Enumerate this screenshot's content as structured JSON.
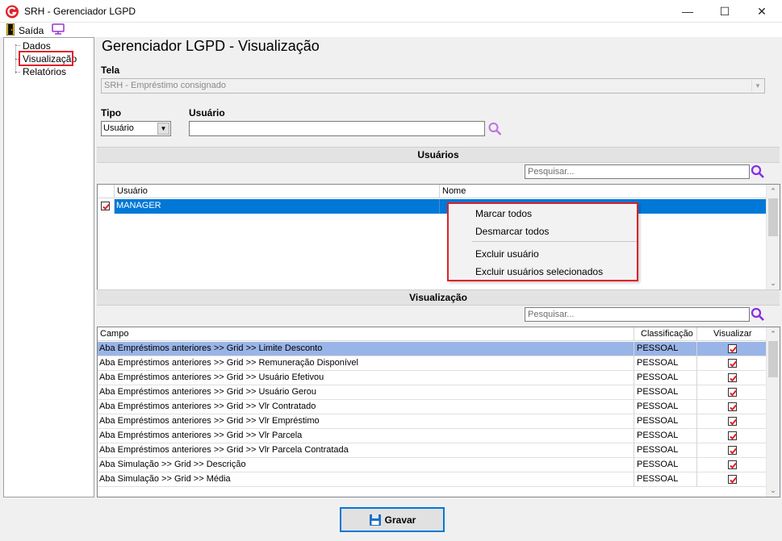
{
  "window": {
    "title": "SRH - Gerenciador LGPD",
    "minimize_glyph": "—",
    "maximize_glyph": "☐",
    "close_glyph": "✕"
  },
  "menu": {
    "exit_label": "Saída"
  },
  "tree": {
    "items": [
      {
        "label": "Dados"
      },
      {
        "label": "Visualização",
        "selected": true
      },
      {
        "label": "Relatórios"
      }
    ]
  },
  "page": {
    "title": "Gerenciador LGPD - Visualização",
    "tela_label": "Tela",
    "tela_value": "SRH - Empréstimo consignado",
    "tipo_label": "Tipo",
    "tipo_value": "Usuário",
    "usuario_label": "Usuário",
    "usuario_value": ""
  },
  "users_section": {
    "title": "Usuários",
    "search_placeholder": "Pesquisar...",
    "columns": [
      "Usuário",
      "Nome"
    ],
    "rows": [
      {
        "checked": true,
        "usuario": "MANAGER",
        "nome": ""
      }
    ]
  },
  "context_menu": {
    "items": [
      "Marcar todos",
      "Desmarcar todos",
      "Excluir usuário",
      "Excluir usuários selecionados"
    ]
  },
  "view_section": {
    "title": "Visualização",
    "search_placeholder": "Pesquisar...",
    "columns": [
      "Campo",
      "Classificação",
      "Visualizar"
    ],
    "rows": [
      {
        "campo": "Aba Empréstimos anteriores >> Grid >> Limite Desconto",
        "classificacao": "PESSOAL",
        "visualizar": true
      },
      {
        "campo": "Aba Empréstimos anteriores >> Grid >> Remuneração Disponível",
        "classificacao": "PESSOAL",
        "visualizar": true
      },
      {
        "campo": "Aba Empréstimos anteriores >> Grid >> Usuário Efetivou",
        "classificacao": "PESSOAL",
        "visualizar": true
      },
      {
        "campo": "Aba Empréstimos anteriores >> Grid >> Usuário Gerou",
        "classificacao": "PESSOAL",
        "visualizar": true
      },
      {
        "campo": "Aba Empréstimos anteriores >> Grid >> Vlr Contratado",
        "classificacao": "PESSOAL",
        "visualizar": true
      },
      {
        "campo": "Aba Empréstimos anteriores >> Grid >> Vlr Empréstimo",
        "classificacao": "PESSOAL",
        "visualizar": true
      },
      {
        "campo": "Aba Empréstimos anteriores >> Grid >> Vlr Parcela",
        "classificacao": "PESSOAL",
        "visualizar": true
      },
      {
        "campo": "Aba Empréstimos anteriores >> Grid >> Vlr Parcela Contratada",
        "classificacao": "PESSOAL",
        "visualizar": true
      },
      {
        "campo": "Aba Simulação >> Grid >> Descrição",
        "classificacao": "PESSOAL",
        "visualizar": true
      },
      {
        "campo": "Aba Simulação >> Grid >> Média",
        "classificacao": "PESSOAL",
        "visualizar": true
      }
    ]
  },
  "footer": {
    "save_label": "Gravar"
  },
  "colors": {
    "selection_blue": "#0078d7",
    "row_highlight": "#99b4e6",
    "accent_red": "#e0202a",
    "search_icon_purple": "#8a2be2"
  }
}
